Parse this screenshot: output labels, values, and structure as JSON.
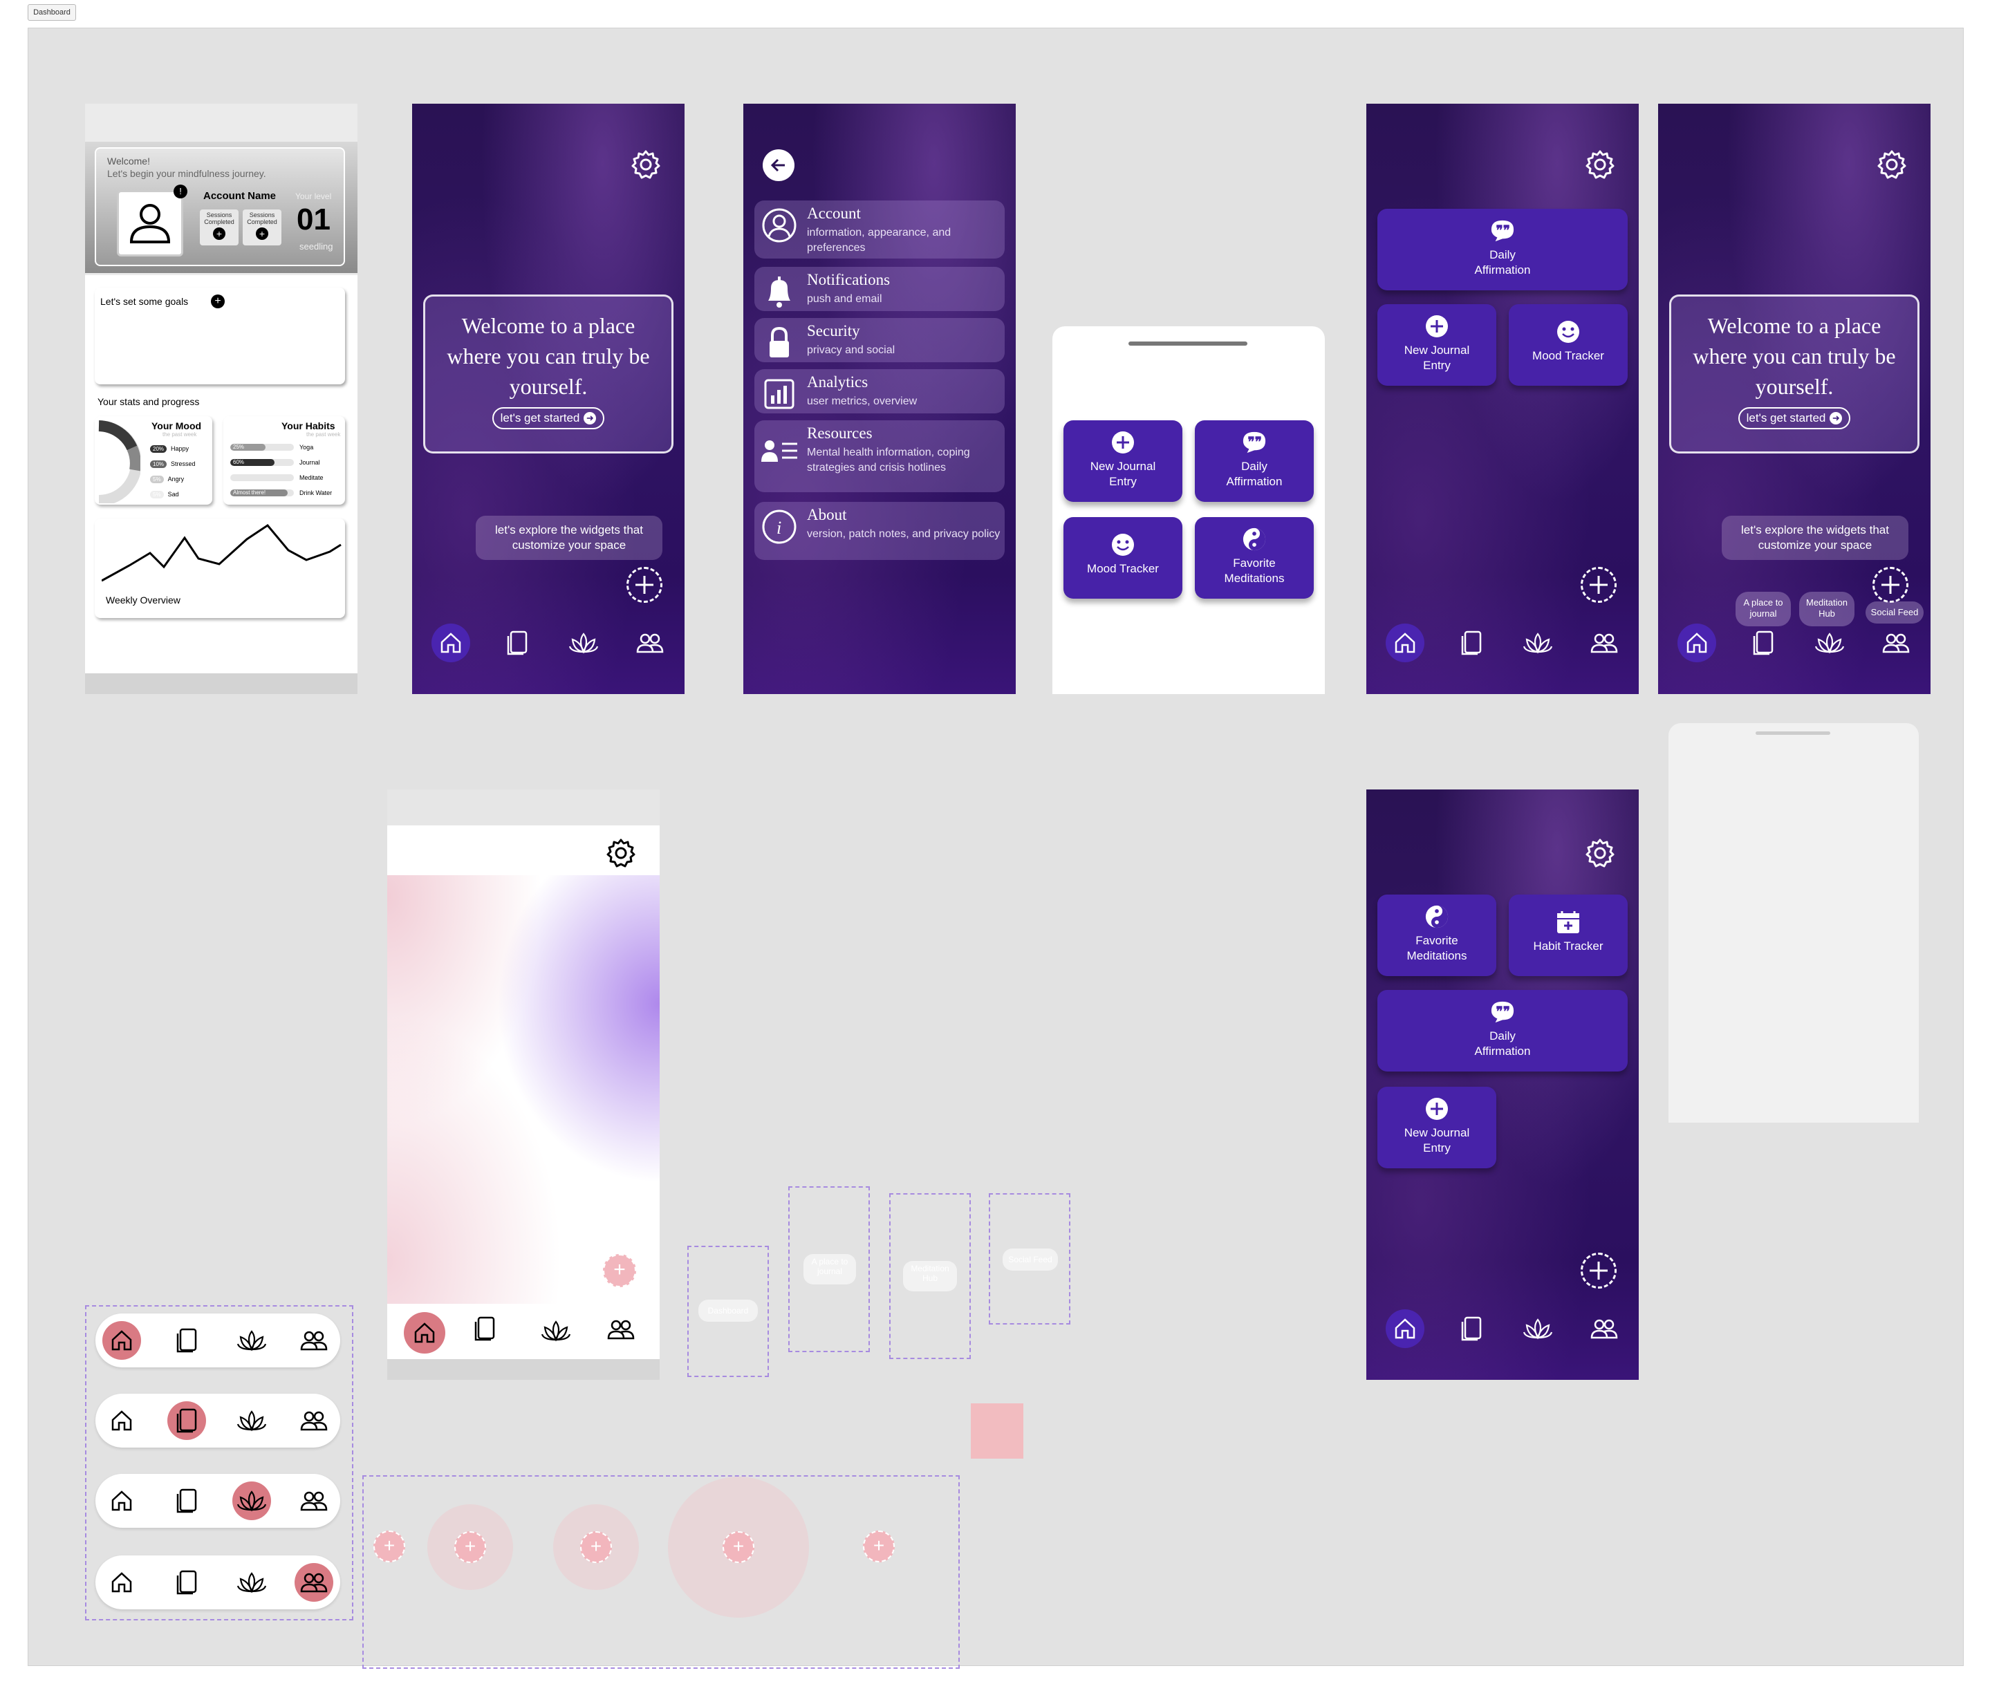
{
  "frame_label": "Dashboard",
  "colors": {
    "canvas": "#e2e2e2",
    "purple_dark": "#2a1254",
    "widget": "#4722a8",
    "pink": "#d97a83"
  },
  "wireframe": {
    "welcome_line1": "Welcome!",
    "welcome_line2": "Let's begin your mindfulness journey.",
    "account_name": "Account Name",
    "sessions_label_1": "Sessions Completed",
    "sessions_label_2": "Sessions Completed",
    "level_label": "Your level",
    "level_value": "01",
    "level_name": "seedling",
    "goals_label": "Let's set some goals",
    "stats_heading": "Your stats and progress",
    "mood_title": "Your Mood",
    "mood_sub": "the past week",
    "mood_rows": [
      {
        "pct": "20%",
        "label": "Happy"
      },
      {
        "pct": "10%",
        "label": "Stressed"
      },
      {
        "pct": "5%",
        "label": "Angry"
      },
      {
        "pct": "5%",
        "label": "Sad"
      }
    ],
    "habits_title": "Your Habits",
    "habits_sub": "the past week",
    "habit_rows": [
      {
        "pct": "25%",
        "label": "Yoga",
        "fill": 0.55
      },
      {
        "pct": "60%",
        "label": "Journal",
        "fill": 0.7
      },
      {
        "pct": "",
        "label": "Meditate",
        "fill": 0.0
      },
      {
        "pct": "Almost there!",
        "label": "Drink Water",
        "fill": 0.9
      }
    ],
    "weekly_label": "Weekly Overview"
  },
  "home": {
    "welcome_text": "Welcome to a place where you can truly be yourself.",
    "start_button": "let's get started",
    "explore_text": "let's explore the widgets that customize your space"
  },
  "settings": {
    "rows": [
      {
        "title": "Account",
        "sub": "information, appearance, and preferences",
        "icon": "user-circle-icon"
      },
      {
        "title": "Notifications",
        "sub": "push and email",
        "icon": "bell-icon"
      },
      {
        "title": "Security",
        "sub": "privacy and social",
        "icon": "lock-icon"
      },
      {
        "title": "Analytics",
        "sub": "user metrics, overview",
        "icon": "chart-icon"
      },
      {
        "title": "Resources",
        "sub": "Mental health information, coping strategies and crisis hotlines",
        "icon": "list-user-icon"
      },
      {
        "title": "About",
        "sub": "version, patch notes, and privacy policy",
        "icon": "info-icon"
      }
    ]
  },
  "widget_sheet": {
    "new_journal": "New Journal Entry",
    "daily_affirmation": "Daily Affirmation",
    "mood_tracker": "Mood Tracker",
    "favorite_meditations": "Favorite Meditations"
  },
  "widgets_screen_1": {
    "daily_affirmation": "Daily Affirmation",
    "new_journal": "New Journal Entry",
    "mood_tracker": "Mood Tracker"
  },
  "home_expanded": {
    "sub_a": "A place to journal",
    "sub_b": "Meditation Hub",
    "sub_c": "Social Feed"
  },
  "widgets_screen_2": {
    "favorite_meditations": "Favorite Meditations",
    "habit_tracker": "Habit Tracker",
    "daily_affirmation": "Daily Affirmation",
    "new_journal": "New Journal Entry"
  },
  "ghost_labels": {
    "dashboard": "Dashboard",
    "journal": "A place to journal",
    "meditation": "Meditation Hub",
    "social": "Social Feed"
  }
}
